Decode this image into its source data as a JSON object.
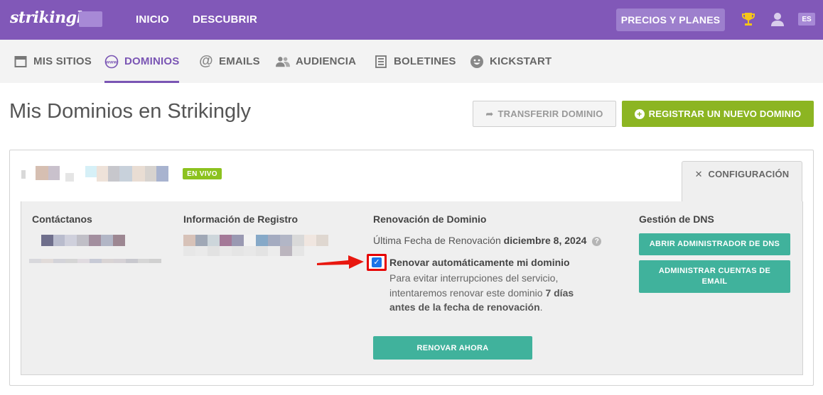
{
  "topbar": {
    "logo": "strikingly",
    "nav": [
      {
        "label": "INICIO"
      },
      {
        "label": "DESCUBRIR"
      }
    ],
    "pricing_label": "PRECIOS Y PLANES",
    "lang": "ES"
  },
  "subnav": {
    "items": [
      {
        "label": "MIS SITIOS",
        "icon": "browser-icon"
      },
      {
        "label": "DOMINIOS",
        "icon": "www-icon",
        "active": true
      },
      {
        "label": "EMAILS",
        "icon": "at-icon"
      },
      {
        "label": "AUDIENCIA",
        "icon": "people-icon"
      },
      {
        "label": "BOLETINES",
        "icon": "newsletter-icon"
      },
      {
        "label": "KICKSTART",
        "icon": "smiley-icon"
      }
    ]
  },
  "page": {
    "title": "Mis Dominios en Strikingly",
    "transfer_label": "TRANSFERIR DOMINIO",
    "register_label": "REGISTRAR UN NUEVO DOMINIO"
  },
  "card": {
    "status_badge": "EN VIVO",
    "config_tab": "CONFIGURACIÓN",
    "contact": {
      "title": "Contáctanos"
    },
    "registration": {
      "title": "Información de Registro"
    },
    "renewal": {
      "title": "Renovación de Dominio",
      "last_date_label": "Última Fecha de Renovación",
      "last_date_value": "diciembre 8, 2024",
      "auto_renew_label": "Renovar automáticamente mi dominio",
      "auto_renew_checked": true,
      "help_part1": "Para evitar interrupciones del servicio, intentaremos renovar este dominio ",
      "help_bold": "7 días antes de la fecha de renovación",
      "help_part2": ".",
      "renew_now_label": "RENOVAR AHORA"
    },
    "dns": {
      "title": "Gestión de DNS",
      "open_dns_label": "ABRIR ADMINISTRADOR DE DNS",
      "manage_email_label": "ADMINISTRAR CUENTAS DE EMAIL"
    }
  },
  "colors": {
    "brand": "#8158b8",
    "accent": "#7a55b4",
    "register_green": "#8cb522",
    "teal": "#40b29c",
    "live_green": "#8cc21f",
    "highlight_red": "#e60000"
  }
}
